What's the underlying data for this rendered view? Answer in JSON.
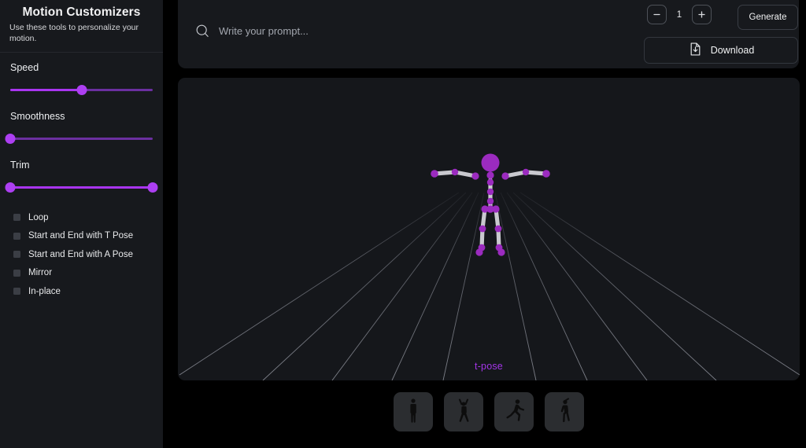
{
  "sidebar": {
    "title": "Motion Customizers",
    "subtitle": "Use these tools to personalize your motion.",
    "sliders": [
      {
        "label": "Speed",
        "value": 50,
        "type": "single"
      },
      {
        "label": "Smoothness",
        "value": 0,
        "type": "single"
      },
      {
        "label": "Trim",
        "start": 0,
        "end": 100,
        "type": "range"
      }
    ],
    "checkboxes": [
      {
        "label": "Loop",
        "checked": false
      },
      {
        "label": "Start and End with T Pose",
        "checked": false
      },
      {
        "label": "Start and End with A Pose",
        "checked": false
      },
      {
        "label": "Mirror",
        "checked": false
      },
      {
        "label": "In-place",
        "checked": false
      }
    ]
  },
  "toolbar": {
    "prompt_placeholder": "Write your prompt...",
    "prompt_value": "",
    "search_icon": "search-icon",
    "count_value": "1",
    "decrement_label": "−",
    "increment_label": "+",
    "generate_label": "Generate",
    "download_label": "Download",
    "download_icon": "file-download-icon"
  },
  "viewport": {
    "pose_label": "t-pose",
    "skeleton_joint_color": "#9b2bbf",
    "skeleton_bone_color": "#c9c9cf",
    "grid_color": "#5a5d66",
    "background": "#15171b"
  },
  "pose_presets": [
    {
      "name": "standing-pose",
      "icon": "person-standing-icon"
    },
    {
      "name": "jumping-jack-pose",
      "icon": "person-arms-up-icon"
    },
    {
      "name": "running-pose",
      "icon": "person-running-icon"
    },
    {
      "name": "walking-pose",
      "icon": "person-walking-icon"
    }
  ],
  "colors": {
    "accent": "#a935f0",
    "accent_dim": "#6b2fa0",
    "panel": "#17191d",
    "viewport": "#15171b",
    "background": "#000000"
  }
}
